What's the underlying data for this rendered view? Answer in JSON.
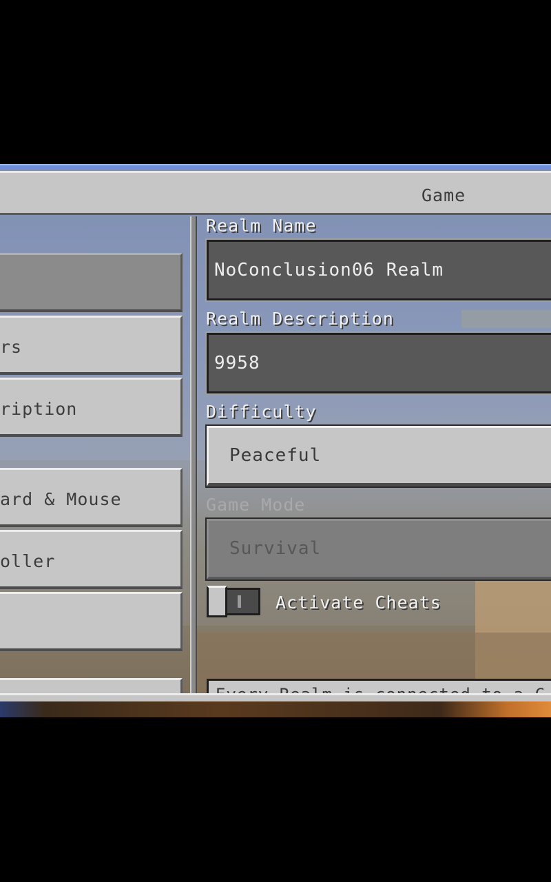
{
  "header": {
    "title": "Game"
  },
  "sidebar": {
    "items": [
      {
        "label": "",
        "selected": true
      },
      {
        "label": "rs"
      },
      {
        "label": "ription"
      },
      {
        "label": "ard & Mouse"
      },
      {
        "label": "oller"
      },
      {
        "label": ""
      },
      {
        "label": ""
      }
    ]
  },
  "form": {
    "realm_name": {
      "label": "Realm Name",
      "value": "NoConclusion06 Realm"
    },
    "realm_description": {
      "label": "Realm Description",
      "value": "9958"
    },
    "difficulty": {
      "label": "Difficulty",
      "value": "Peaceful"
    },
    "game_mode": {
      "label": "Game Mode",
      "value": "Survival",
      "enabled": false
    },
    "cheats": {
      "label": "Activate Cheats",
      "enabled": false
    },
    "notice": "Every Realm is connected to a C"
  },
  "colors": {
    "panel": "#c6c6c6",
    "field_bg": "#585858",
    "accent_line": "#6f8fd8",
    "label_text": "#f0f0f0"
  }
}
